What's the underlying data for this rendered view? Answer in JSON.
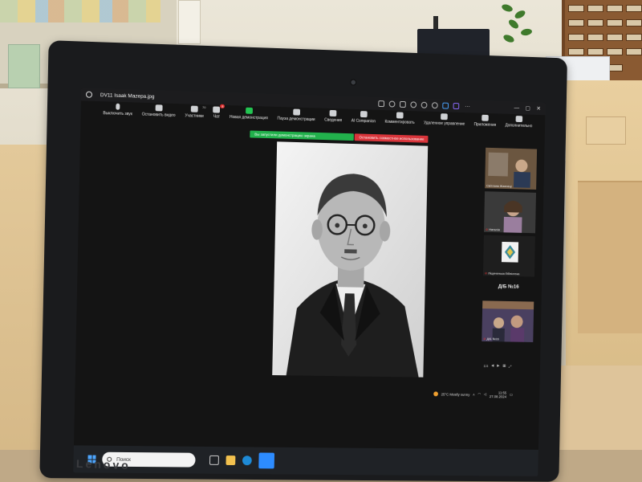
{
  "zoom": {
    "window_title": "DV11 Isaak Mazepa.jpg",
    "toolbar": [
      {
        "label": "Выключить звук",
        "icon": "microphone-icon"
      },
      {
        "label": "Остановить видео",
        "icon": "video-camera-icon"
      },
      {
        "label": "Участники",
        "icon": "participants-icon",
        "count": "70"
      },
      {
        "label": "Чат",
        "icon": "chat-icon",
        "badge": "8"
      },
      {
        "label": "Новая демонстрация",
        "icon": "share-screen-icon"
      },
      {
        "label": "Пауза демонстрации",
        "icon": "pause-icon"
      },
      {
        "label": "Сведения",
        "icon": "info-icon"
      },
      {
        "label": "AI Companion",
        "icon": "ai-companion-icon"
      },
      {
        "label": "Комментировать",
        "icon": "annotate-icon"
      },
      {
        "label": "Удаленное управление",
        "icon": "remote-control-icon"
      },
      {
        "label": "Приложения",
        "icon": "apps-icon"
      },
      {
        "label": "Дополнительно",
        "icon": "more-icon"
      }
    ],
    "share_banner": "Вы запустили демонстрацию экрана",
    "stop_share": "Остановить совместное использование",
    "participants": [
      {
        "name": "Світлана Жаннеці"
      },
      {
        "name": "Наталія"
      },
      {
        "name": "Ліщиненька бібліотека"
      },
      {
        "name": "Д/Б №16"
      },
      {
        "name": "Д/Б №16"
      }
    ],
    "gallery_page": "1/4"
  },
  "windows": {
    "search_placeholder": "Поиск",
    "weather": "25°C  Mostly sunny",
    "clock_time": "11:55",
    "clock_date": "27.08.2024"
  },
  "laptop": {
    "brand": "Lenovo"
  }
}
